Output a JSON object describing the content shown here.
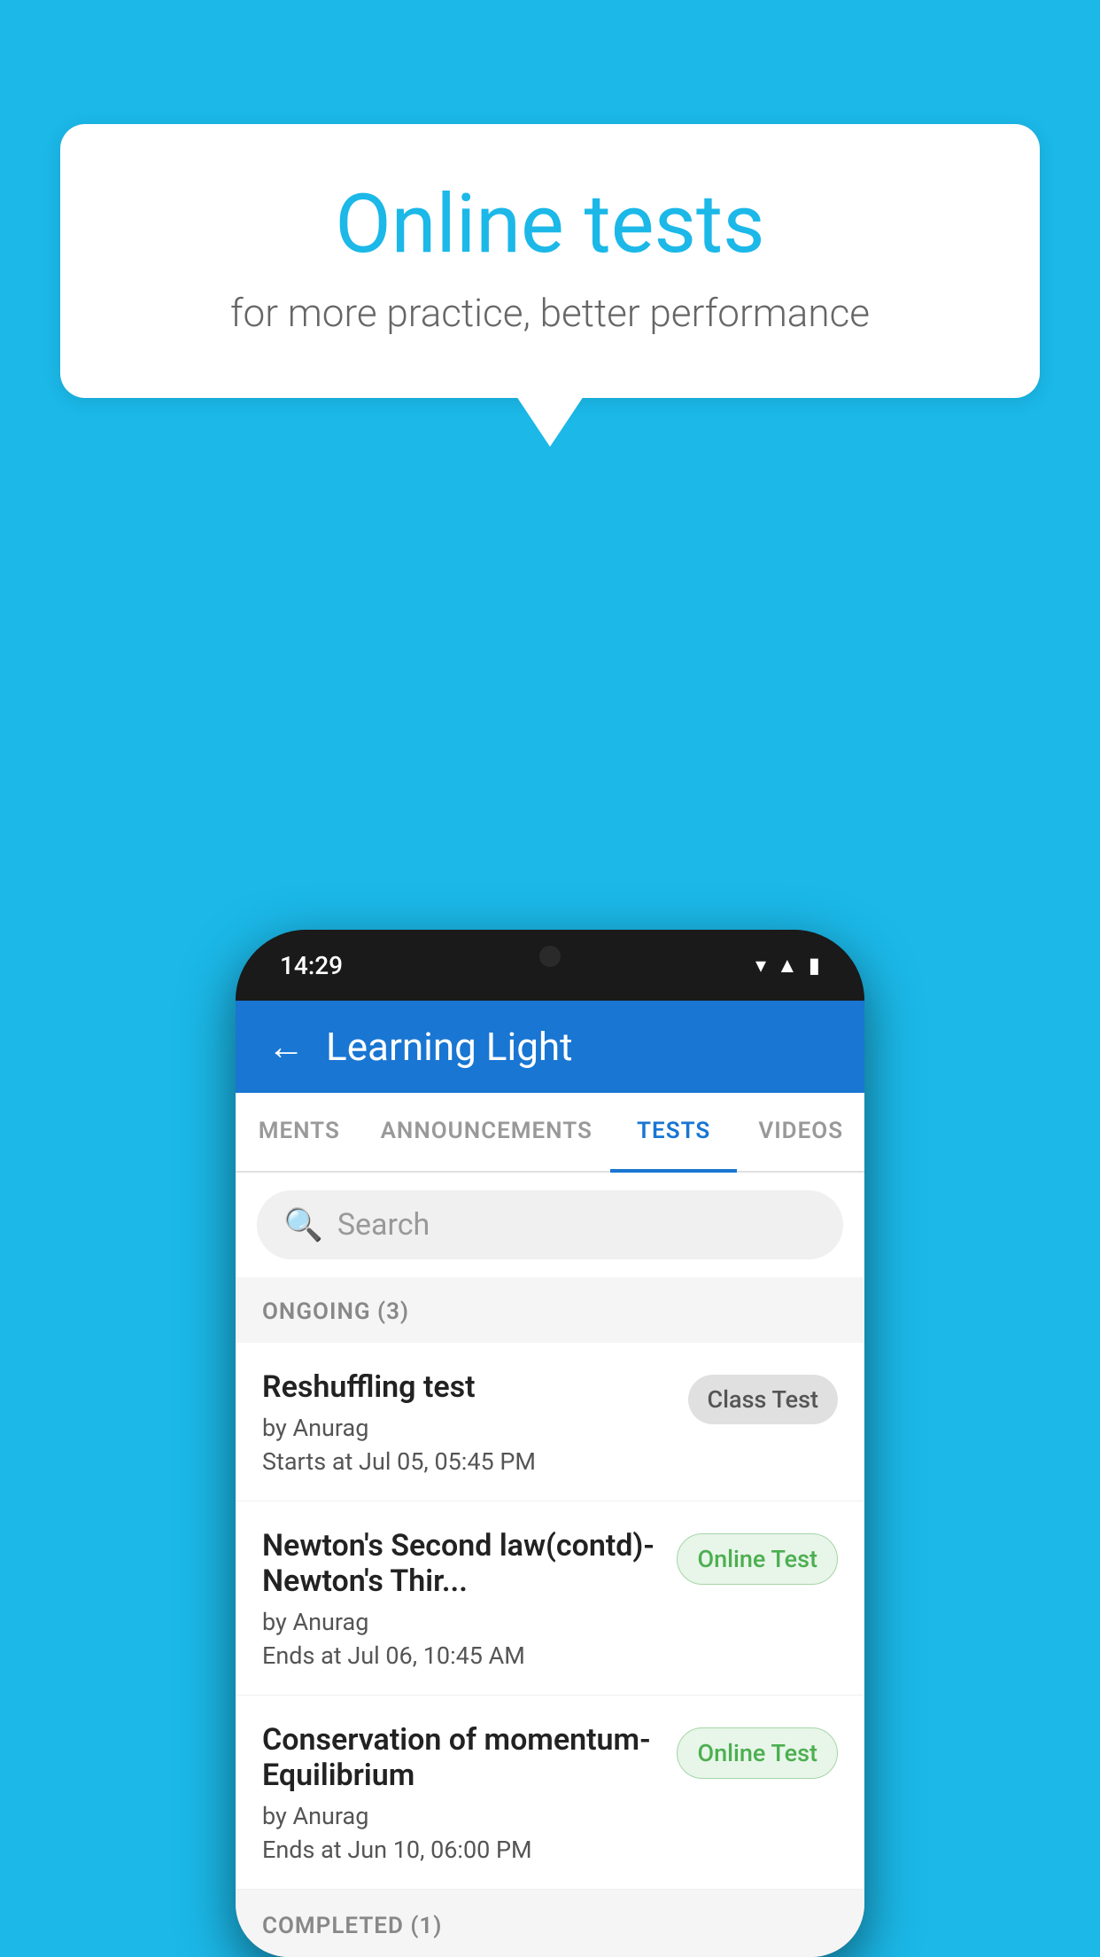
{
  "background_color": "#1BB8E8",
  "speech_bubble": {
    "title": "Online tests",
    "subtitle": "for more practice, better performance"
  },
  "phone": {
    "status_bar": {
      "time": "14:29",
      "icons": [
        "wifi",
        "signal",
        "battery"
      ]
    },
    "header": {
      "title": "Learning Light",
      "back_label": "←"
    },
    "tabs": [
      {
        "label": "MENTS",
        "active": false
      },
      {
        "label": "ANNOUNCEMENTS",
        "active": false
      },
      {
        "label": "TESTS",
        "active": true
      },
      {
        "label": "VIDEOS",
        "active": false
      }
    ],
    "search": {
      "placeholder": "Search"
    },
    "ongoing_section": {
      "label": "ONGOING (3)"
    },
    "tests": [
      {
        "name": "Reshuffling test",
        "by": "by Anurag",
        "time": "Starts at  Jul 05, 05:45 PM",
        "badge": "Class Test",
        "badge_type": "class"
      },
      {
        "name": "Newton's Second law(contd)-Newton's Thir...",
        "by": "by Anurag",
        "time": "Ends at  Jul 06, 10:45 AM",
        "badge": "Online Test",
        "badge_type": "online"
      },
      {
        "name": "Conservation of momentum-Equilibrium",
        "by": "by Anurag",
        "time": "Ends at  Jun 10, 06:00 PM",
        "badge": "Online Test",
        "badge_type": "online"
      }
    ],
    "completed_section": {
      "label": "COMPLETED (1)"
    }
  }
}
